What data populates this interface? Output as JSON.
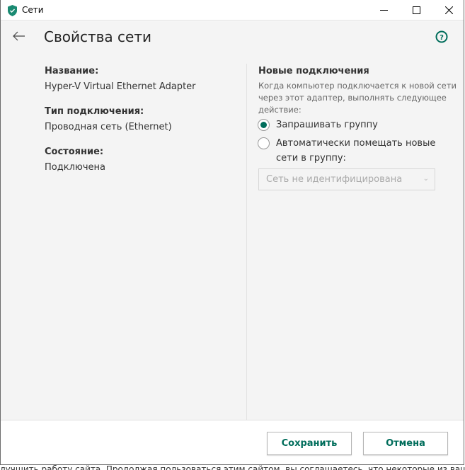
{
  "window": {
    "title": "Сети"
  },
  "header": {
    "title": "Свойства сети"
  },
  "props": [
    {
      "label": "Название:",
      "value": "Hyper-V Virtual Ethernet Adapter"
    },
    {
      "label": "Тип подключения:",
      "value": "Проводная сеть (Ethernet)"
    },
    {
      "label": "Состояние:",
      "value": "Подключена"
    }
  ],
  "new_connections": {
    "title": "Новые подключения",
    "description": "Когда компьютер подключается к новой сети через этот адаптер, выполнять следующее действие:",
    "options": [
      {
        "label": "Запрашивать группу",
        "selected": true
      },
      {
        "label": "Автоматически помещать новые сети в группу:",
        "selected": false
      }
    ],
    "group_select": {
      "value": "Сеть не идентифицирована",
      "disabled": true
    }
  },
  "footer": {
    "save": "Сохранить",
    "cancel": "Отмена"
  },
  "background_text": "лучшить работу сайта. Продолжая пользоваться этим сайтом, вы соглашаетесь, что некоторые из ваших действий в браузере",
  "colors": {
    "accent": "#006d5b"
  }
}
